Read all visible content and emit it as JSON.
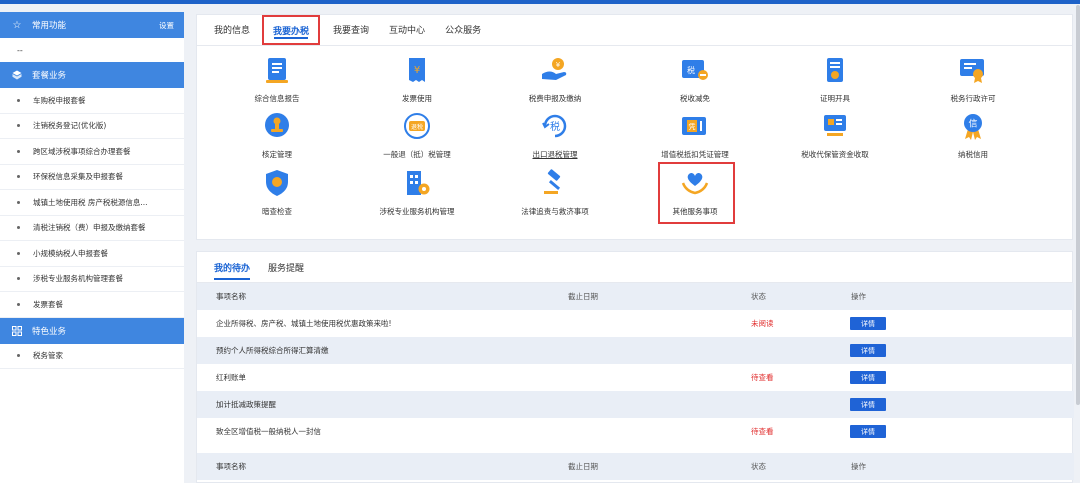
{
  "sidebar": {
    "common": {
      "label": "常用功能",
      "settings": "设置",
      "placeholder": "--"
    },
    "package": {
      "label": "套餐业务",
      "items": [
        "车购税申报套餐",
        "注销税务登记(优化版)",
        "跨区域涉税事项综合办理套餐",
        "环保税信息采集及申报套餐",
        "城镇土地使用税 房产税税源信息...",
        "清税注销税（费）申报及缴纳套餐",
        "小规模纳税人申报套餐",
        "涉税专业服务机构管理套餐",
        "发票套餐"
      ]
    },
    "special": {
      "label": "特色业务",
      "items": [
        "税务管家"
      ]
    }
  },
  "tabs": [
    "我的信息",
    "我要办税",
    "我要查询",
    "互动中心",
    "公众服务"
  ],
  "services": [
    "综合信息报告",
    "发票使用",
    "税费申报及缴纳",
    "税收减免",
    "证明开具",
    "税务行政许可",
    "核定管理",
    "一般退（抵）税管理",
    "出口退税管理",
    "增值税抵扣凭证管理",
    "税收代保管资金收取",
    "纳税信用",
    "暗查检查",
    "涉税专业服务机构管理",
    "法律追责与救济事项",
    "其他服务事项"
  ],
  "icon_text": {
    "tax_reduce": "税",
    "refund": "退税",
    "export": "税",
    "voucher": "凭",
    "credit": "信"
  },
  "todo": {
    "tabs": [
      "我的待办",
      "服务提醒"
    ],
    "headers": {
      "name": "事项名称",
      "date": "截止日期",
      "status": "状态",
      "op": "操作"
    },
    "rows": [
      {
        "name": "企业所得税、房产税、城镇土地使用税优惠政策来啦!",
        "date": "",
        "status": "未阅读",
        "action": "详情"
      },
      {
        "name": "预约个人所得税综合所得汇算清缴",
        "date": "",
        "status": "",
        "action": "详情"
      },
      {
        "name": "红利账单",
        "date": "",
        "status": "待查看",
        "action": "详情"
      },
      {
        "name": "加计抵减政策提醒",
        "date": "",
        "status": "",
        "action": "详情"
      },
      {
        "name": "致全区增值税一般纳税人一封信",
        "date": "",
        "status": "待查看",
        "action": "详情"
      }
    ]
  },
  "colors": {
    "primary": "#1f63d6",
    "sidebar_header": "#3f86e0",
    "highlight": "#e13c3c",
    "status_red": "#e02a2a"
  }
}
